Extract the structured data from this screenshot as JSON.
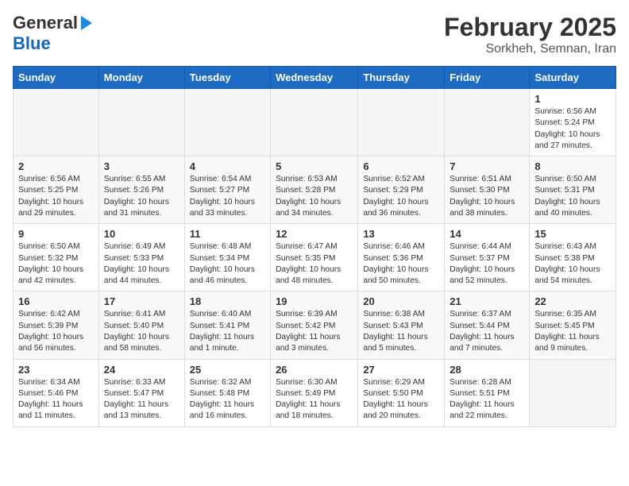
{
  "logo": {
    "line1": "General",
    "line2": "Blue"
  },
  "title": "February 2025",
  "subtitle": "Sorkheh, Semnan, Iran",
  "days_of_week": [
    "Sunday",
    "Monday",
    "Tuesday",
    "Wednesday",
    "Thursday",
    "Friday",
    "Saturday"
  ],
  "weeks": [
    [
      {
        "day": "",
        "info": ""
      },
      {
        "day": "",
        "info": ""
      },
      {
        "day": "",
        "info": ""
      },
      {
        "day": "",
        "info": ""
      },
      {
        "day": "",
        "info": ""
      },
      {
        "day": "",
        "info": ""
      },
      {
        "day": "1",
        "info": "Sunrise: 6:56 AM\nSunset: 5:24 PM\nDaylight: 10 hours and 27 minutes."
      }
    ],
    [
      {
        "day": "2",
        "info": "Sunrise: 6:56 AM\nSunset: 5:25 PM\nDaylight: 10 hours and 29 minutes."
      },
      {
        "day": "3",
        "info": "Sunrise: 6:55 AM\nSunset: 5:26 PM\nDaylight: 10 hours and 31 minutes."
      },
      {
        "day": "4",
        "info": "Sunrise: 6:54 AM\nSunset: 5:27 PM\nDaylight: 10 hours and 33 minutes."
      },
      {
        "day": "5",
        "info": "Sunrise: 6:53 AM\nSunset: 5:28 PM\nDaylight: 10 hours and 34 minutes."
      },
      {
        "day": "6",
        "info": "Sunrise: 6:52 AM\nSunset: 5:29 PM\nDaylight: 10 hours and 36 minutes."
      },
      {
        "day": "7",
        "info": "Sunrise: 6:51 AM\nSunset: 5:30 PM\nDaylight: 10 hours and 38 minutes."
      },
      {
        "day": "8",
        "info": "Sunrise: 6:50 AM\nSunset: 5:31 PM\nDaylight: 10 hours and 40 minutes."
      }
    ],
    [
      {
        "day": "9",
        "info": "Sunrise: 6:50 AM\nSunset: 5:32 PM\nDaylight: 10 hours and 42 minutes."
      },
      {
        "day": "10",
        "info": "Sunrise: 6:49 AM\nSunset: 5:33 PM\nDaylight: 10 hours and 44 minutes."
      },
      {
        "day": "11",
        "info": "Sunrise: 6:48 AM\nSunset: 5:34 PM\nDaylight: 10 hours and 46 minutes."
      },
      {
        "day": "12",
        "info": "Sunrise: 6:47 AM\nSunset: 5:35 PM\nDaylight: 10 hours and 48 minutes."
      },
      {
        "day": "13",
        "info": "Sunrise: 6:46 AM\nSunset: 5:36 PM\nDaylight: 10 hours and 50 minutes."
      },
      {
        "day": "14",
        "info": "Sunrise: 6:44 AM\nSunset: 5:37 PM\nDaylight: 10 hours and 52 minutes."
      },
      {
        "day": "15",
        "info": "Sunrise: 6:43 AM\nSunset: 5:38 PM\nDaylight: 10 hours and 54 minutes."
      }
    ],
    [
      {
        "day": "16",
        "info": "Sunrise: 6:42 AM\nSunset: 5:39 PM\nDaylight: 10 hours and 56 minutes."
      },
      {
        "day": "17",
        "info": "Sunrise: 6:41 AM\nSunset: 5:40 PM\nDaylight: 10 hours and 58 minutes."
      },
      {
        "day": "18",
        "info": "Sunrise: 6:40 AM\nSunset: 5:41 PM\nDaylight: 11 hours and 1 minute."
      },
      {
        "day": "19",
        "info": "Sunrise: 6:39 AM\nSunset: 5:42 PM\nDaylight: 11 hours and 3 minutes."
      },
      {
        "day": "20",
        "info": "Sunrise: 6:38 AM\nSunset: 5:43 PM\nDaylight: 11 hours and 5 minutes."
      },
      {
        "day": "21",
        "info": "Sunrise: 6:37 AM\nSunset: 5:44 PM\nDaylight: 11 hours and 7 minutes."
      },
      {
        "day": "22",
        "info": "Sunrise: 6:35 AM\nSunset: 5:45 PM\nDaylight: 11 hours and 9 minutes."
      }
    ],
    [
      {
        "day": "23",
        "info": "Sunrise: 6:34 AM\nSunset: 5:46 PM\nDaylight: 11 hours and 11 minutes."
      },
      {
        "day": "24",
        "info": "Sunrise: 6:33 AM\nSunset: 5:47 PM\nDaylight: 11 hours and 13 minutes."
      },
      {
        "day": "25",
        "info": "Sunrise: 6:32 AM\nSunset: 5:48 PM\nDaylight: 11 hours and 16 minutes."
      },
      {
        "day": "26",
        "info": "Sunrise: 6:30 AM\nSunset: 5:49 PM\nDaylight: 11 hours and 18 minutes."
      },
      {
        "day": "27",
        "info": "Sunrise: 6:29 AM\nSunset: 5:50 PM\nDaylight: 11 hours and 20 minutes."
      },
      {
        "day": "28",
        "info": "Sunrise: 6:28 AM\nSunset: 5:51 PM\nDaylight: 11 hours and 22 minutes."
      },
      {
        "day": "",
        "info": ""
      }
    ]
  ]
}
